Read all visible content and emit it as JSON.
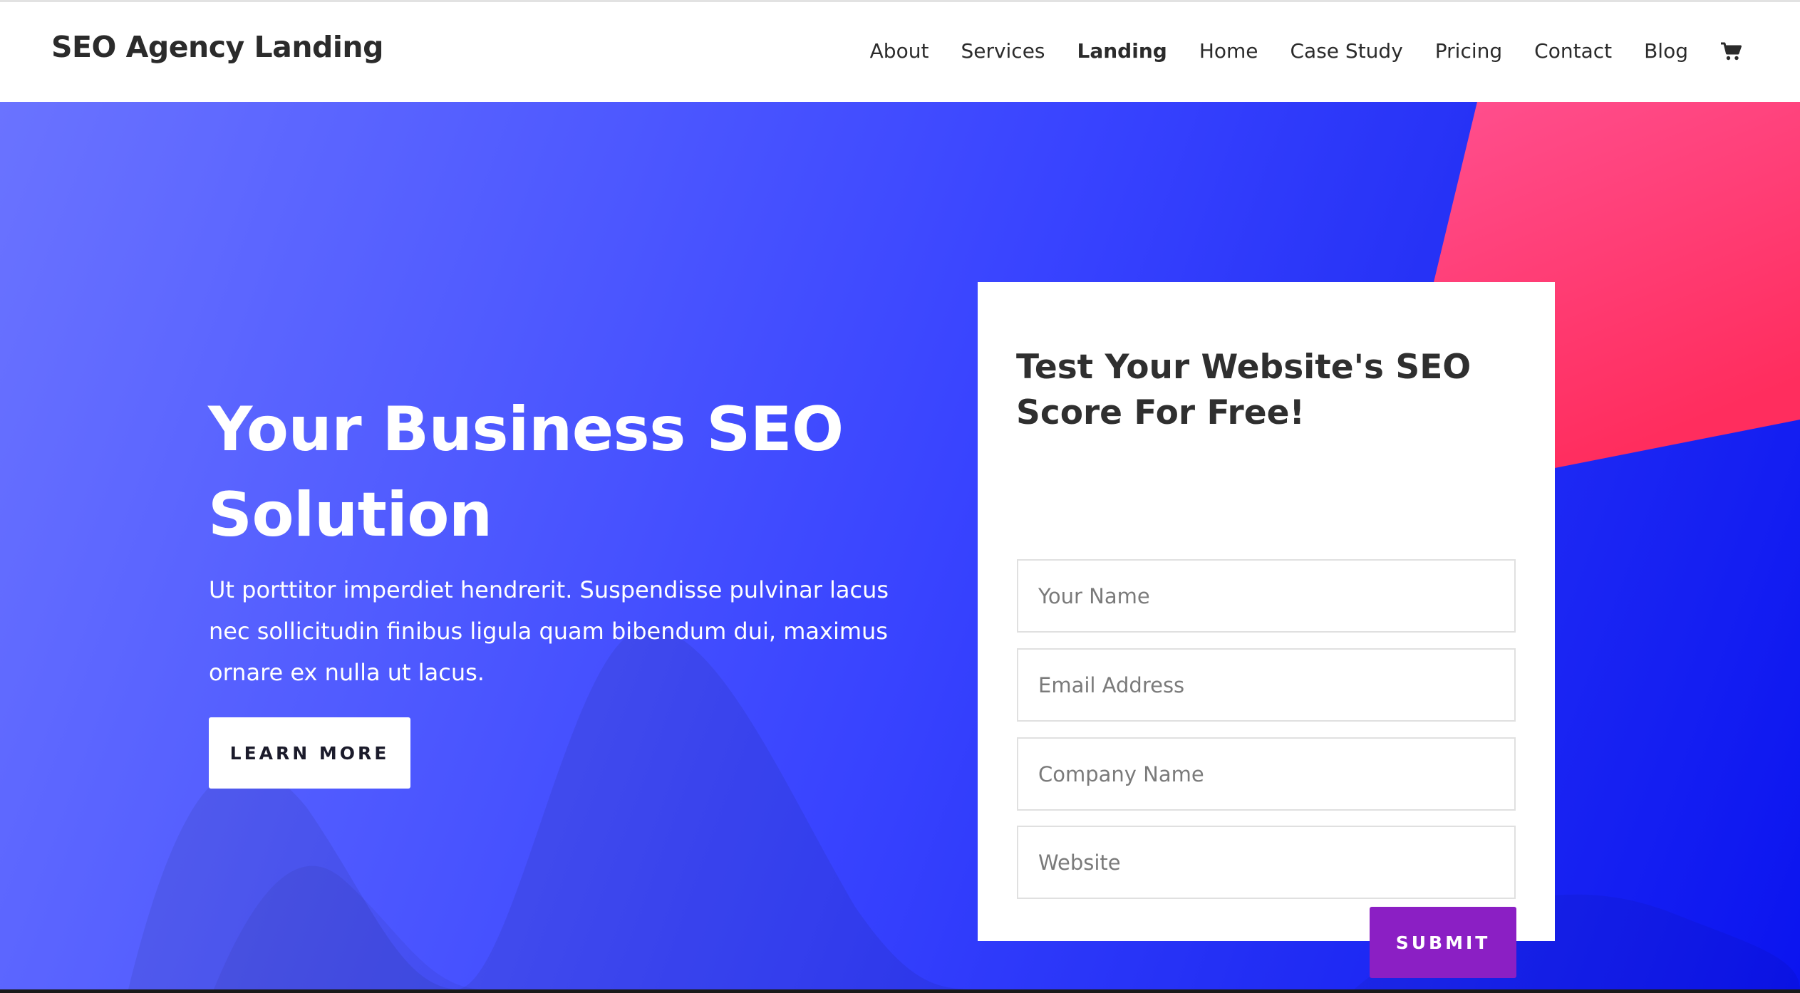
{
  "header": {
    "logo": "SEO Agency Landing",
    "nav": [
      {
        "label": "About",
        "active": false
      },
      {
        "label": "Services",
        "active": false
      },
      {
        "label": "Landing",
        "active": true
      },
      {
        "label": "Home",
        "active": false
      },
      {
        "label": "Case Study",
        "active": false
      },
      {
        "label": "Pricing",
        "active": false
      },
      {
        "label": "Contact",
        "active": false
      },
      {
        "label": "Blog",
        "active": false
      }
    ],
    "cart_icon": "shopping-cart-icon"
  },
  "hero": {
    "heading_line1": "Your Business SEO",
    "heading_line2": "Solution",
    "text": "Ut porttitor imperdiet hendrerit. Suspendisse pulvinar lacus nec sollicitudin finibus ligula quam bibendum dui, maximus ornare ex nulla ut lacus.",
    "cta_label": "LEARN MORE"
  },
  "form": {
    "title": "Test Your Website's SEO Score For Free!",
    "fields": {
      "name_placeholder": "Your Name",
      "email_placeholder": "Email Address",
      "company_placeholder": "Company Name",
      "website_placeholder": "Website"
    },
    "submit_label": "SUBMIT"
  },
  "colors": {
    "hero_gradient_start": "#6a73ff",
    "hero_gradient_end": "#0b14f0",
    "pink_accent": "#ff3d73",
    "submit_purple": "#8b1fc4"
  }
}
